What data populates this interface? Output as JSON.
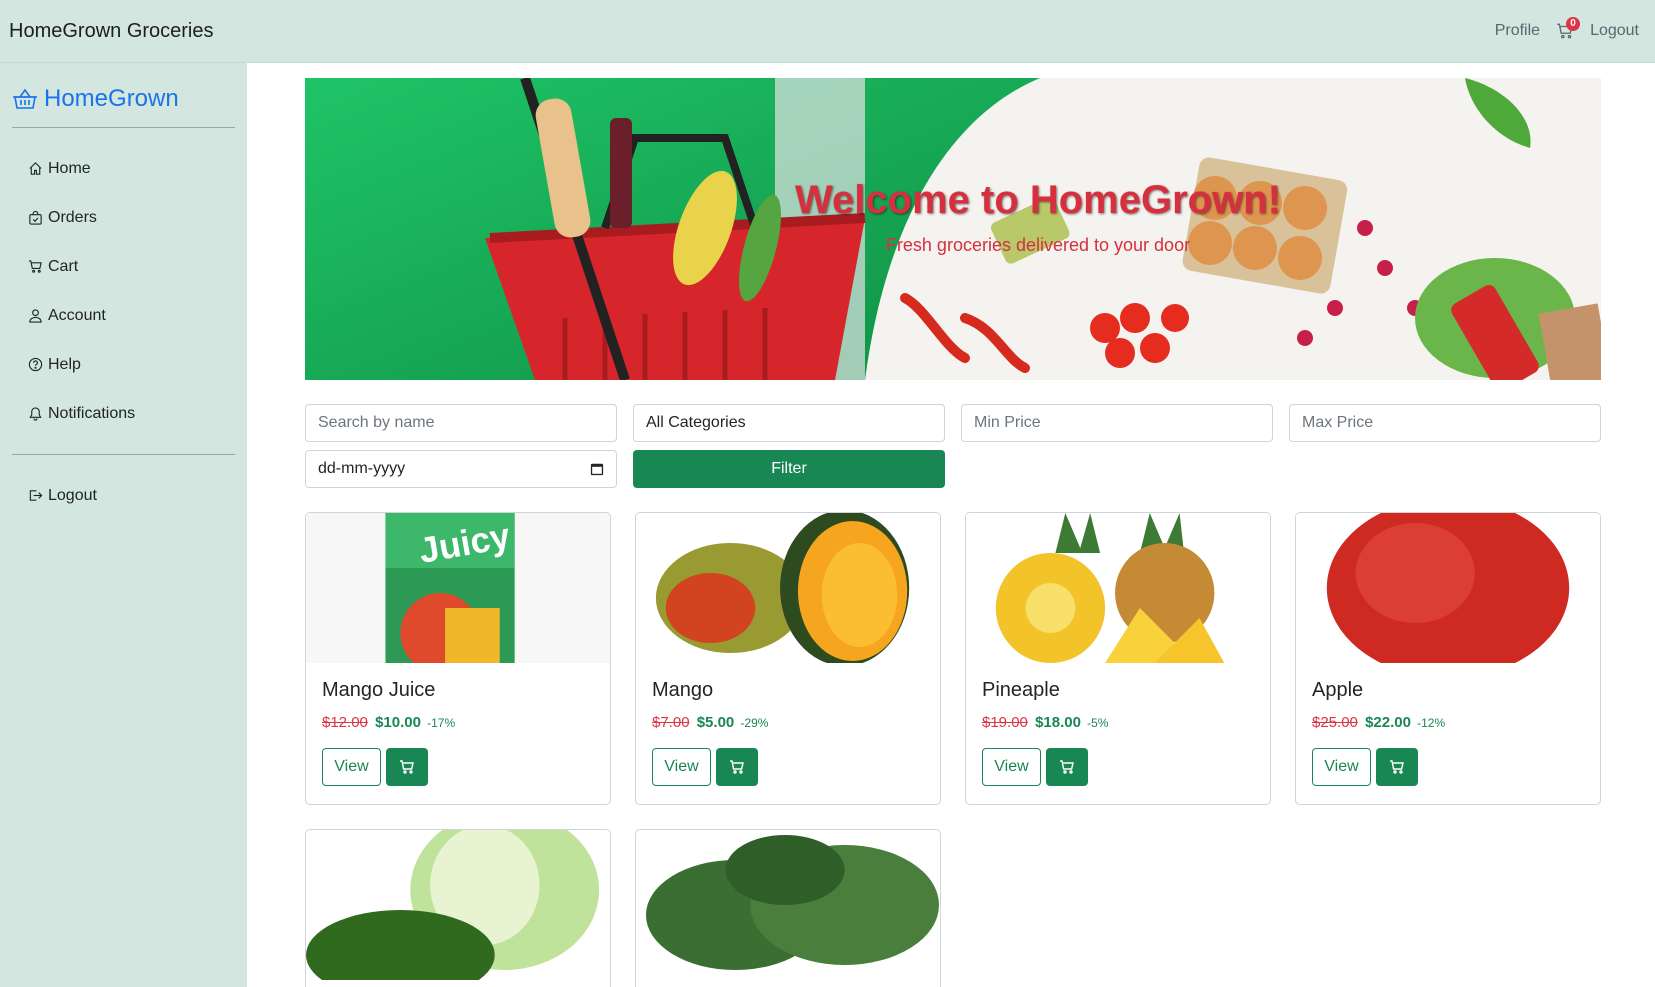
{
  "navbar": {
    "brand": "HomeGrown Groceries",
    "profile_label": "Profile",
    "cart_count": "0",
    "logout_label": "Logout"
  },
  "sidebar": {
    "brand": "HomeGrown",
    "items": [
      {
        "label": "Home",
        "icon": "house-icon"
      },
      {
        "label": "Orders",
        "icon": "bag-check-icon"
      },
      {
        "label": "Cart",
        "icon": "cart-icon"
      },
      {
        "label": "Account",
        "icon": "person-icon"
      },
      {
        "label": "Help",
        "icon": "question-circle-icon"
      },
      {
        "label": "Notifications",
        "icon": "bell-icon"
      }
    ],
    "logout_label": "Logout"
  },
  "hero": {
    "title": "Welcome to HomeGrown!",
    "subtitle": "Fresh groceries delivered to your door"
  },
  "filters": {
    "search_placeholder": "Search by name",
    "category_value": "All Categories",
    "min_price_placeholder": "Min Price",
    "max_price_placeholder": "Max Price",
    "date_placeholder": "dd-mm-yyyy",
    "filter_label": "Filter"
  },
  "products": [
    {
      "name": "Mango Juice",
      "old_price": "$12.00",
      "new_price": "$10.00",
      "discount": "-17%"
    },
    {
      "name": "Mango",
      "old_price": "$7.00",
      "new_price": "$5.00",
      "discount": "-29%"
    },
    {
      "name": "Pineaple",
      "old_price": "$19.00",
      "new_price": "$18.00",
      "discount": "-5%"
    },
    {
      "name": "Apple",
      "old_price": "$25.00",
      "new_price": "$22.00",
      "discount": "-12%"
    }
  ],
  "card_actions": {
    "view_label": "View"
  },
  "colors": {
    "nav_bg": "#d3e6df",
    "brand_blue": "#1a73e8",
    "primary_green": "#198754",
    "price_red": "#dc3545",
    "hero_red": "#d6303f"
  }
}
